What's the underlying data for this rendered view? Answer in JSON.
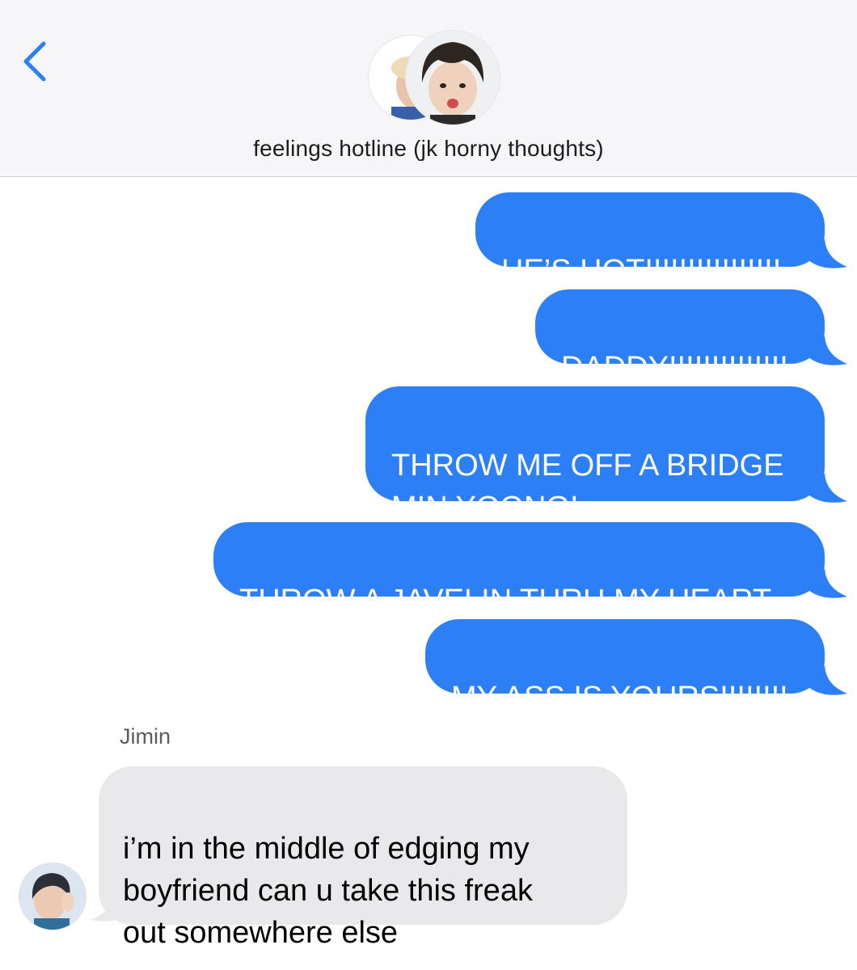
{
  "header": {
    "title": "feelings hotline (jk horny thoughts)",
    "back_icon": "chevron-left-icon",
    "accent_color": "#2d7ff6"
  },
  "messages": [
    {
      "direction": "sent",
      "text": "HE’S HOT!!!!!!!!!!!!!!!!"
    },
    {
      "direction": "sent",
      "text": "DADDY!!!!!!!!!!!!!!"
    },
    {
      "direction": "sent",
      "text": "THROW ME OFF A BRIDGE\nMIN YOONGI"
    },
    {
      "direction": "sent",
      "text": "THROW A JAVELIN THRU MY HEART"
    },
    {
      "direction": "sent",
      "text": "MY ASS IS YOURS!!!!!!!!"
    },
    {
      "direction": "received",
      "sender": "Jimin",
      "text": "i’m in the middle of edging my\nboyfriend can u take this freak\nout somewhere else"
    }
  ],
  "colors": {
    "sent_bubble": "#2d7ff6",
    "received_bubble": "#e9e9eb",
    "header_bg": "#f6f6f8"
  }
}
